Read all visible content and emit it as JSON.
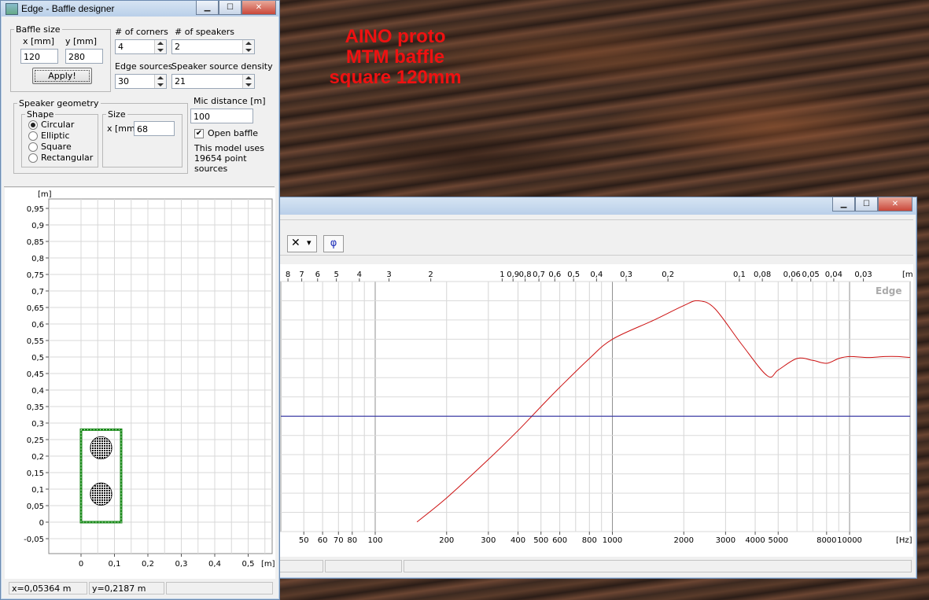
{
  "overlay_title": [
    "AINO proto",
    "MTM baffle",
    "square 120mm"
  ],
  "designer": {
    "title": "Edge - Baffle designer",
    "baffle_size": {
      "legend": "Baffle size",
      "x_label": "x [mm]",
      "y_label": "y [mm]",
      "x_value": "120",
      "y_value": "280",
      "apply_label": "Apply!"
    },
    "corners": {
      "label": "# of corners",
      "value": "4"
    },
    "speakers": {
      "label": "# of speakers",
      "value": "2"
    },
    "edge_sources": {
      "label": "Edge sources",
      "value": "30"
    },
    "density": {
      "label": "Speaker source density",
      "value": "21"
    },
    "geometry": {
      "legend": "Speaker geometry",
      "shape_legend": "Shape",
      "shapes": [
        "Circular",
        "Elliptic",
        "Square",
        "Rectangular"
      ],
      "selected": "Circular",
      "size_legend": "Size",
      "size_label": "x [mm]",
      "size_value": "68"
    },
    "mic": {
      "label": "Mic distance [m]",
      "value": "100",
      "open_baffle_label": "Open baffle",
      "open_baffle_checked": "✔"
    },
    "info": [
      "This model uses",
      "19654 point",
      "sources"
    ],
    "plot": {
      "y_unit": "[m]",
      "x_unit": "[m]",
      "y_ticks": [
        "0,95",
        "0,9",
        "0,85",
        "0,8",
        "0,75",
        "0,7",
        "0,65",
        "0,6",
        "0,55",
        "0,5",
        "0,45",
        "0,4",
        "0,35",
        "0,3",
        "0,25",
        "0,2",
        "0,15",
        "0,1",
        "0,05",
        "0",
        "-0,05"
      ],
      "x_ticks": [
        "0",
        "0,1",
        "0,2",
        "0,3",
        "0,4",
        "0,5"
      ]
    },
    "status": {
      "x": "x=0,05364 m",
      "y": "y=0,2187 m"
    }
  },
  "response": {
    "toolbar": {
      "cross_icon": "✕",
      "dropdown_icon": "▾",
      "phi_label": "φ"
    },
    "watermark": "Edge",
    "top_ticks": [
      "8",
      "7",
      "6",
      "5",
      "4",
      "3",
      "2",
      "1",
      "0,9",
      "0,8",
      "0,7",
      "0,6",
      "0,5",
      "0,4",
      "0,3",
      "0,2",
      "0,1",
      "0,08",
      "0,06",
      "0,05",
      "0,04",
      "0,03",
      "[m]"
    ],
    "bottom_ticks": [
      "50",
      "60",
      "70",
      "80",
      "100",
      "200",
      "300",
      "400",
      "500",
      "600",
      "800",
      "1000",
      "2000",
      "3000",
      "4000",
      "5000",
      "8000",
      "10000",
      "[Hz]"
    ]
  },
  "chart_data": {
    "type": "line",
    "x_scale": "log",
    "xlabel": "[Hz]",
    "x2label": "[m]",
    "series": [
      {
        "color": "#cc1111",
        "x": [
          150,
          200,
          300,
          400,
          500,
          600,
          800,
          1000,
          1500,
          2000,
          2300,
          2700,
          3500,
          4500,
          5000,
          6000,
          7000,
          8000,
          9000,
          10000,
          12000,
          14000,
          16000,
          18000
        ],
        "y": [
          -19,
          -16.5,
          -12.5,
          -9.5,
          -7,
          -5,
          -2,
          0,
          2,
          3.5,
          4,
          3.2,
          -0.5,
          -3.8,
          -3.2,
          -2,
          -2.2,
          -2.5,
          -2,
          -1.8,
          -1.9,
          -1.8,
          -1.8,
          -1.9
        ]
      },
      {
        "color": "#1a1a99",
        "x": [
          40,
          18000
        ],
        "y": [
          -8,
          -8
        ]
      }
    ],
    "ylim": [
      -20,
      6
    ],
    "xlim": [
      40,
      18000
    ],
    "grid": true
  }
}
